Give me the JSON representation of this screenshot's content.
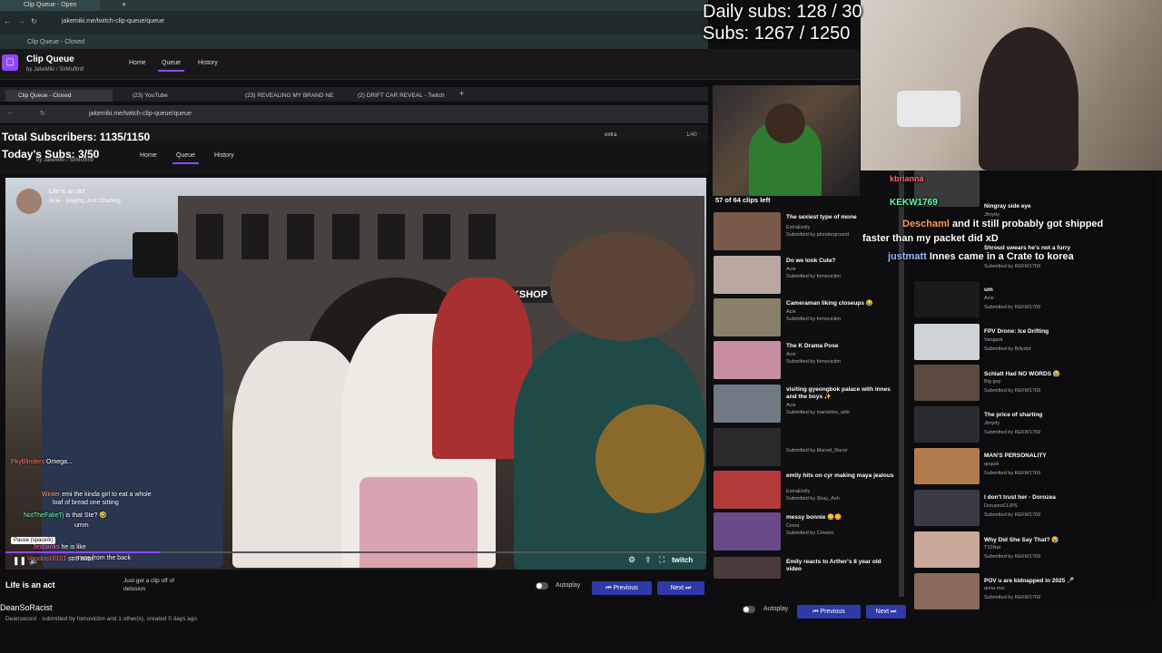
{
  "outer_browser": {
    "tab1": "Clip Queue - Open",
    "url": "jakemiki.me/twitch-clip-queue/queue",
    "bookmark": "Clip Queue - Closed"
  },
  "app": {
    "title": "Clip Queue",
    "subtitle": "by JakeMiki / SirMuffin9",
    "nav": [
      "Home",
      "Queue",
      "History"
    ]
  },
  "inner_browser": {
    "tabs": [
      "Clip Queue - Closed",
      "(23) YouTube",
      "(23) REVEALING MY BRAND NE",
      "(2) DRIFT CAR REVEAL - Twitch"
    ],
    "url": "jakemiki.me/twitch-clip-queue/queue",
    "search_text": "extra",
    "page_count": "1/40"
  },
  "overlays": {
    "total_subs": "Total Subscribers: 1135/1150",
    "today_subs": "Today's Subs: 3/50",
    "daily_subs": "Daily subs: 128 / 30",
    "subs": "Subs: 1267 / 1250"
  },
  "video": {
    "info_title": "Life is an act",
    "info_channel": "Acie · playing Just Chatting",
    "info_views": "13 views",
    "shop_sign": "BOOKSHOP",
    "pause_tooltip": "Pause (space/k)",
    "chat": [
      {
        "name": "PkyBlinders",
        "text": "Omega..."
      },
      {
        "name": "Winter",
        "text": "emi the kinda girl to eat a whole"
      },
      {
        "name": "",
        "text": "loaf of bread one sitting"
      },
      {
        "name": "NotTheFakeTj",
        "text": "is that Ste? 🤣"
      },
      {
        "name": "",
        "text": "umm"
      },
      {
        "name": "Jesbanks",
        "text": "he is like"
      },
      {
        "name": "",
        "text": "mog from the back"
      },
      {
        "name": "Voodoo10101",
        "text": "str8 aura"
      }
    ],
    "watermark": "twitch"
  },
  "below_video": {
    "clip_title": "Life is an act",
    "comment": "Just get a clip off of delusion",
    "autoplay": "Autoplay",
    "previous": "Previous",
    "next": "Next",
    "channel": "DeanSoRacist",
    "meta": "Deansocool · submitted by fomovictim and 1 other(s), created 5 days ago"
  },
  "queue": {
    "count": "57 of 64 clips left",
    "clips": [
      {
        "title": "The sexiest type of mone",
        "channel": "ExtraEmily",
        "by": "Submitted by plunderground",
        "color": "#7a5a4a"
      },
      {
        "title": "Do we look Cute?",
        "channel": "Acie",
        "by": "Submitted by fomovictim",
        "color": "#b9a7a0"
      },
      {
        "title": "Cameraman liking closeups 😂",
        "channel": "Acie",
        "by": "Submitted by fomovictim",
        "color": "#8a7f68"
      },
      {
        "title": "The K Drama Pose",
        "channel": "Acie",
        "by": "Submitted by fomovictim",
        "color": "#c78fa0"
      },
      {
        "title": "visiting gyeongbok palace with innes and the boys ✨",
        "channel": "Acie",
        "by": "Submitted by manishke_wife",
        "color": "#6f7a84"
      },
      {
        "title": "",
        "channel": "",
        "by": "Submitted by Marvel_Racer",
        "color": "#2a2a2d"
      },
      {
        "title": "emily hits on cyr making maya jealous",
        "channel": "ExtraEmily",
        "by": "Submitted by Shay_Ash",
        "color": "#b23a3a"
      },
      {
        "title": "messy bonnie 😋😋",
        "channel": "Cinna",
        "by": "Submitted by CHvent",
        "color": "#6b4a8a"
      },
      {
        "title": "Emily reacts to Arther's 8 year old video",
        "channel": "",
        "by": "",
        "color": "#4a3a3a"
      }
    ],
    "autoplay": "Autoplay",
    "previous": "Previous",
    "next": "Next"
  },
  "right_list": [
    {
      "title": "Ningray side eye",
      "channel": "Jlmytty",
      "by": "Submitted by KEKW1769",
      "color": "#3a3a3d"
    },
    {
      "title": "Shroud swears he's not a furry",
      "channel": "",
      "by": "Submitted by KEKW1769",
      "color": "#3a3a3d"
    },
    {
      "title": "um",
      "channel": "Acie",
      "by": "Submitted by KEKW1769",
      "color": "#1a1a1c"
    },
    {
      "title": "FPV Drone: Ice Drifting",
      "channel": "Vangard",
      "by": "Submitted by Billydot",
      "color": "#cfd3d8"
    },
    {
      "title": "Schlatt Had NO WORDS 😭",
      "channel": "Big guy",
      "by": "Submitted by KEKW1769",
      "color": "#5a4a40"
    },
    {
      "title": "The price of sharting",
      "channel": "Jlmytty",
      "by": "Submitted by KEKW1769",
      "color": "#2a2a30"
    },
    {
      "title": "MAN'S PERSONALITY",
      "channel": "qoquik",
      "by": "Submitted by KEKW1769",
      "color": "#b07a4a"
    },
    {
      "title": "I don't trust her - Dorozea",
      "channel": "DoruzeaCLIPS",
      "by": "Submitted by KEKW1769",
      "color": "#3a3a44"
    },
    {
      "title": "Why Did She Say That? 😭",
      "channel": "T10Nat",
      "by": "Submitted by KEKW1769",
      "color": "#c9a89a"
    },
    {
      "title": "POV u are kidnapped in 2025 🎤",
      "channel": "anna mei",
      "by": "Submitted by KEKW1769",
      "color": "#8a6a5a"
    }
  ],
  "stream_chat": [
    {
      "name": "kbrianna",
      "text": ""
    },
    {
      "name": "KEKW1769",
      "text": ""
    },
    {
      "name": "Deschaml",
      "text": "and it still probably got shipped"
    },
    {
      "name": "",
      "text": "faster than my packet did xD"
    },
    {
      "name": "justmatt",
      "text": "Innes came in a Crate to korea"
    }
  ]
}
